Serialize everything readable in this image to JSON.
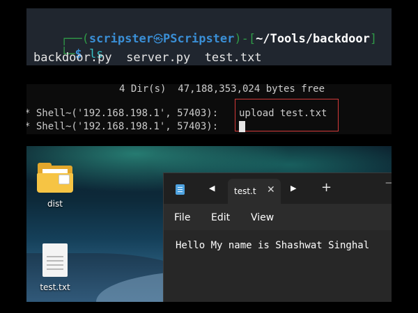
{
  "kali_terminal": {
    "corner_top": "┌──(",
    "user": "scripster",
    "skull": "㉿",
    "host": "PScripster",
    "sep": ")-[",
    "cwd": "~/Tools/backdoor",
    "close_bracket": "]",
    "corner_bottom": "└─",
    "prompt": "$",
    "command": "ls",
    "files": [
      "backdoor.py",
      "server.py",
      "test.txt"
    ]
  },
  "cmd_shell": {
    "dir_summary": "4 Dir(s)  47,188,353,024 bytes free",
    "prompt_1": "* Shell~('192.168.198.1', 57403):",
    "command_1": "upload test.txt",
    "prompt_2": "* Shell~('192.168.198.1', 57403):"
  },
  "desktop": {
    "icons": [
      {
        "label": "dist",
        "icon": "folder-icon"
      },
      {
        "label": "test.txt",
        "icon": "text-file-icon"
      }
    ]
  },
  "notepad": {
    "tab_title": "test.t",
    "menu": [
      "File",
      "Edit",
      "View"
    ],
    "content": "Hello My name is Shashwat Singhal",
    "accent": "#4fa3e0"
  }
}
